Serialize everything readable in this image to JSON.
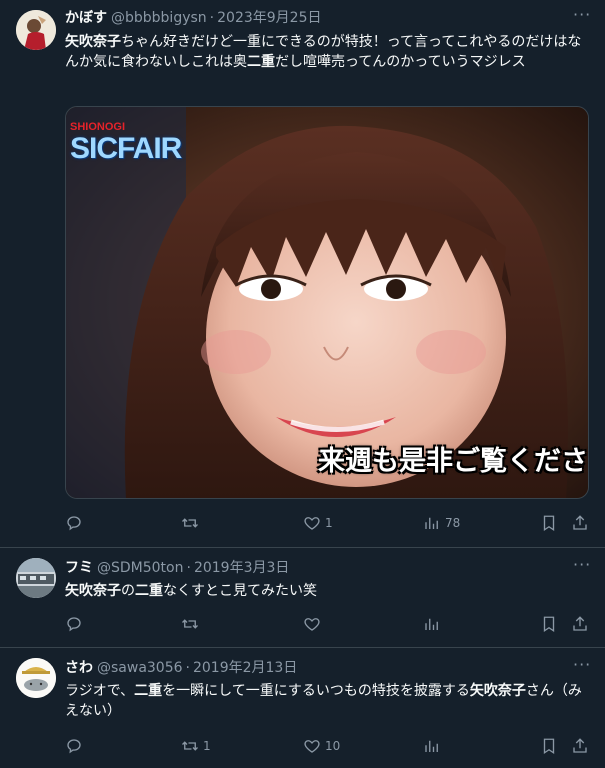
{
  "tweets": [
    {
      "name": "かぼす",
      "handle": "@bbbbbigysn",
      "date": "2023年9月25日",
      "text_parts": [
        {
          "t": "矢吹奈子",
          "b": true
        },
        {
          "t": "ちゃん好きだけど一重にできるのが特技！って言ってこれやるのだけはなんか気に食わないしこれは奥",
          "b": false
        },
        {
          "t": "二重",
          "b": true
        },
        {
          "t": "だし喧嘩売ってんのかっていうマジレス",
          "b": false
        }
      ],
      "media": {
        "logo_top": "SHIONOGI",
        "logo_main": "SICFAIR",
        "caption": "来週も是非ご覧ください"
      },
      "actions": {
        "reply": "",
        "retweet": "",
        "like": "1",
        "views": "78"
      }
    },
    {
      "name": "フミ",
      "handle": "@SDM50ton",
      "date": "2019年3月3日",
      "text_parts": [
        {
          "t": "矢吹奈子",
          "b": true
        },
        {
          "t": "の",
          "b": false
        },
        {
          "t": "二重",
          "b": true
        },
        {
          "t": "なくすとこ見てみたい笑",
          "b": false
        }
      ],
      "actions": {
        "reply": "",
        "retweet": "",
        "like": "",
        "views": ""
      }
    },
    {
      "name": "さわ",
      "handle": "@sawa3056",
      "date": "2019年2月13日",
      "text_parts": [
        {
          "t": "ラジオで、",
          "b": false
        },
        {
          "t": "二重",
          "b": true
        },
        {
          "t": "を一瞬にして一重にするいつもの特技を披露する",
          "b": false
        },
        {
          "t": "矢吹奈子",
          "b": true
        },
        {
          "t": "さん（みえない）",
          "b": false
        }
      ],
      "actions": {
        "reply": "",
        "retweet": "1",
        "like": "10",
        "views": ""
      }
    }
  ],
  "separator": "·",
  "more_glyph": "···",
  "colors": {
    "bg": "#15202b",
    "text": "#f7f9f9",
    "muted": "#8b98a5",
    "border": "#38444d"
  }
}
